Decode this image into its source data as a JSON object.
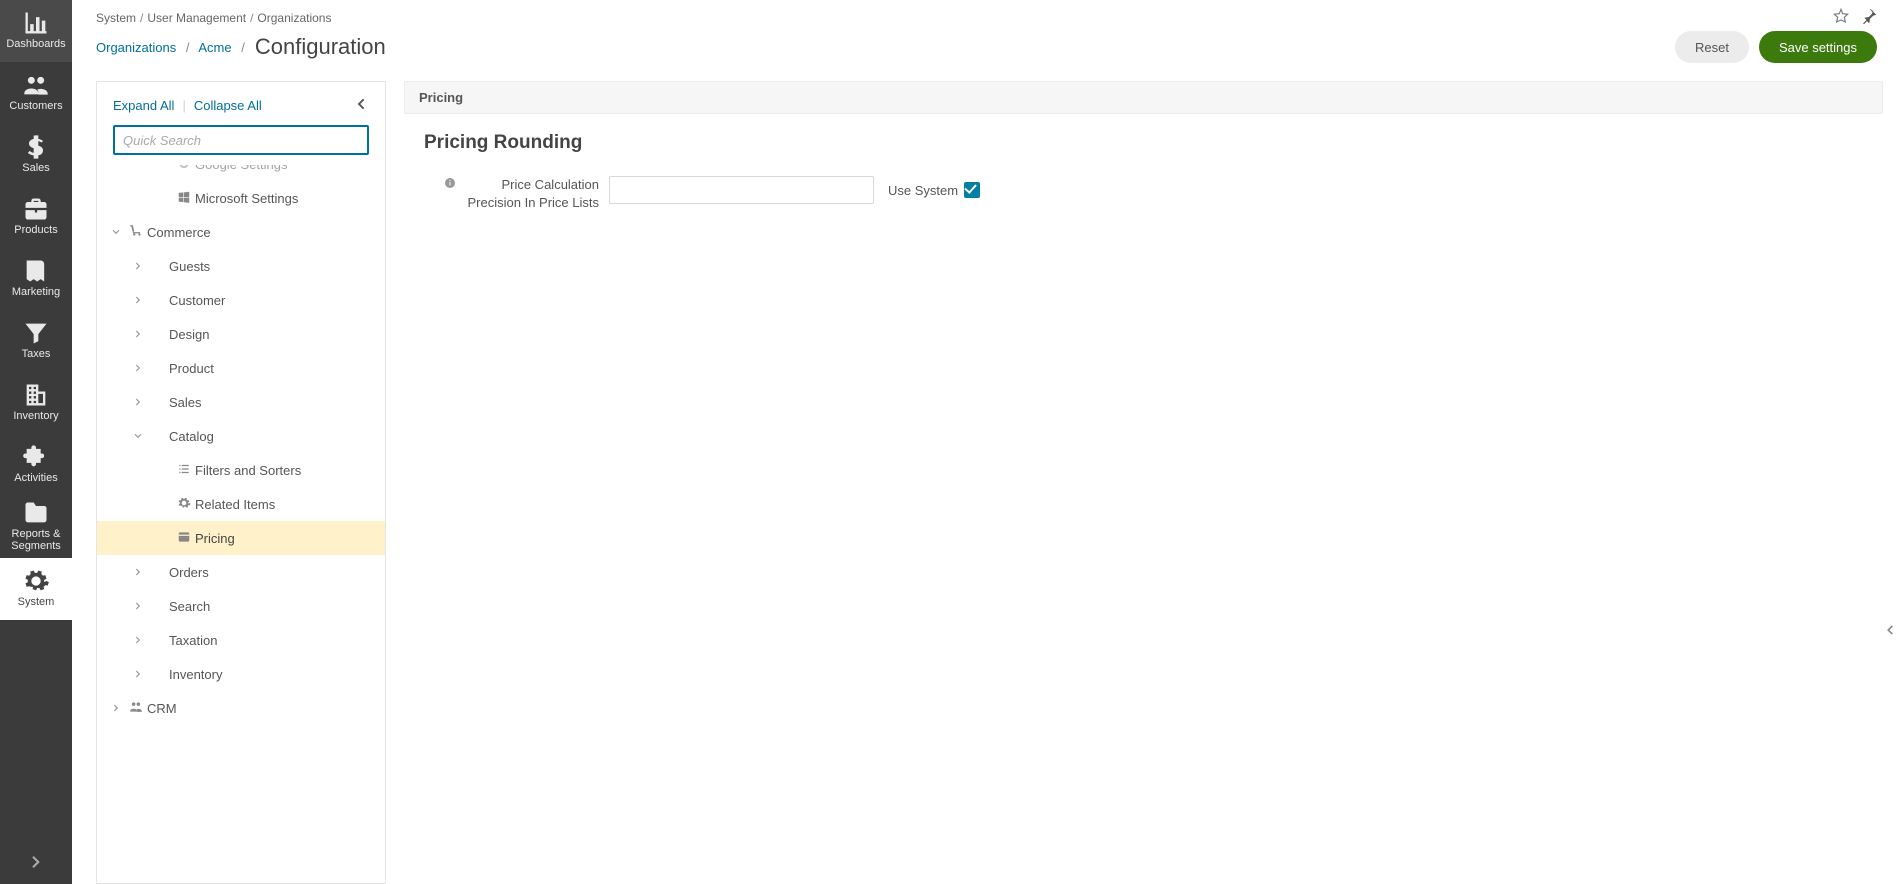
{
  "nav": [
    {
      "key": "dashboards",
      "label": "Dashboards",
      "icon": "bar"
    },
    {
      "key": "customers",
      "label": "Customers",
      "icon": "users"
    },
    {
      "key": "sales",
      "label": "Sales",
      "icon": "dollar"
    },
    {
      "key": "products",
      "label": "Products",
      "icon": "briefcase"
    },
    {
      "key": "marketing",
      "label": "Marketing",
      "icon": "book"
    },
    {
      "key": "taxes",
      "label": "Taxes",
      "icon": "funnel"
    },
    {
      "key": "inventory",
      "label": "Inventory",
      "icon": "building"
    },
    {
      "key": "activities",
      "label": "Activities",
      "icon": "puzzle"
    },
    {
      "key": "reports",
      "label": "Reports & Segments",
      "icon": "folder"
    },
    {
      "key": "system",
      "label": "System",
      "icon": "gear",
      "active": true
    }
  ],
  "breadcrumb_small": [
    "System",
    "User Management",
    "Organizations"
  ],
  "title_crumbs": {
    "org_index": "Organizations",
    "org": "Acme",
    "page": "Configuration"
  },
  "buttons": {
    "reset": "Reset",
    "save": "Save settings"
  },
  "config_header": {
    "expand": "Expand All",
    "collapse": "Collapse All"
  },
  "search_placeholder": "Quick Search",
  "tree": [
    {
      "level": 2,
      "type": "leaf",
      "label": "Google Settings",
      "icon": "google",
      "cut": true
    },
    {
      "level": 2,
      "type": "leaf",
      "label": "Microsoft Settings",
      "icon": "windows"
    },
    {
      "level": 0,
      "type": "branch-open",
      "label": "Commerce",
      "icon": "cart"
    },
    {
      "level": 1,
      "type": "branch",
      "label": "Guests"
    },
    {
      "level": 1,
      "type": "branch",
      "label": "Customer"
    },
    {
      "level": 1,
      "type": "branch",
      "label": "Design"
    },
    {
      "level": 1,
      "type": "branch",
      "label": "Product"
    },
    {
      "level": 1,
      "type": "branch",
      "label": "Sales"
    },
    {
      "level": 1,
      "type": "branch-open",
      "label": "Catalog"
    },
    {
      "level": 2,
      "type": "leaf",
      "label": "Filters and Sorters",
      "icon": "list"
    },
    {
      "level": 2,
      "type": "leaf",
      "label": "Related Items",
      "icon": "gear"
    },
    {
      "level": 2,
      "type": "leaf",
      "label": "Pricing",
      "icon": "card",
      "selected": true
    },
    {
      "level": 1,
      "type": "branch",
      "label": "Orders"
    },
    {
      "level": 1,
      "type": "branch",
      "label": "Search"
    },
    {
      "level": 1,
      "type": "branch",
      "label": "Taxation"
    },
    {
      "level": 1,
      "type": "branch",
      "label": "Inventory"
    },
    {
      "level": 0,
      "type": "branch",
      "label": "CRM",
      "icon": "crm"
    }
  ],
  "panel": {
    "header": "Pricing",
    "section": "Pricing Rounding",
    "field_label": "Price Calculation Precision In Price Lists",
    "field_value": "",
    "use_system_label": "Use System",
    "use_system_checked": true
  }
}
